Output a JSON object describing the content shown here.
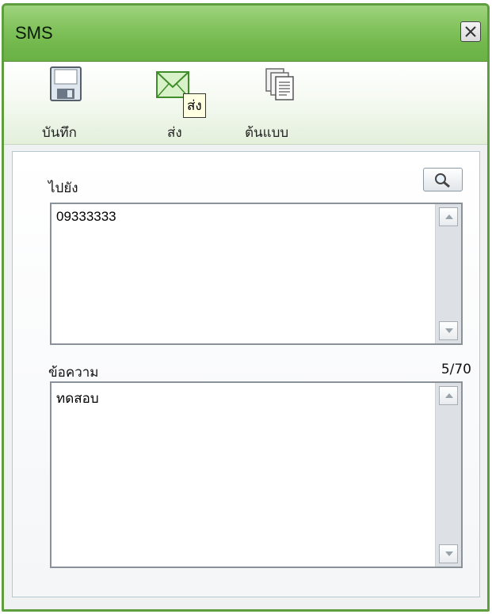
{
  "window": {
    "title": "SMS"
  },
  "toolbar": {
    "save_label": "บันทึก",
    "send_label": "ส่ง",
    "template_label": "ต้นแบบ",
    "tooltip": "ส่ง"
  },
  "form": {
    "to_label": "ไปยัง",
    "to_value": "09333333",
    "message_label": "ข้อความ",
    "message_value": "ทดสอบ",
    "char_count": "5/70"
  },
  "icons": {
    "save": "floppy-disk-icon",
    "send": "envelope-icon",
    "template": "documents-icon",
    "search": "magnifier-icon",
    "close": "close-icon"
  },
  "colors": {
    "titlebar": "#7bbd55",
    "border": "#5f9e3f"
  }
}
